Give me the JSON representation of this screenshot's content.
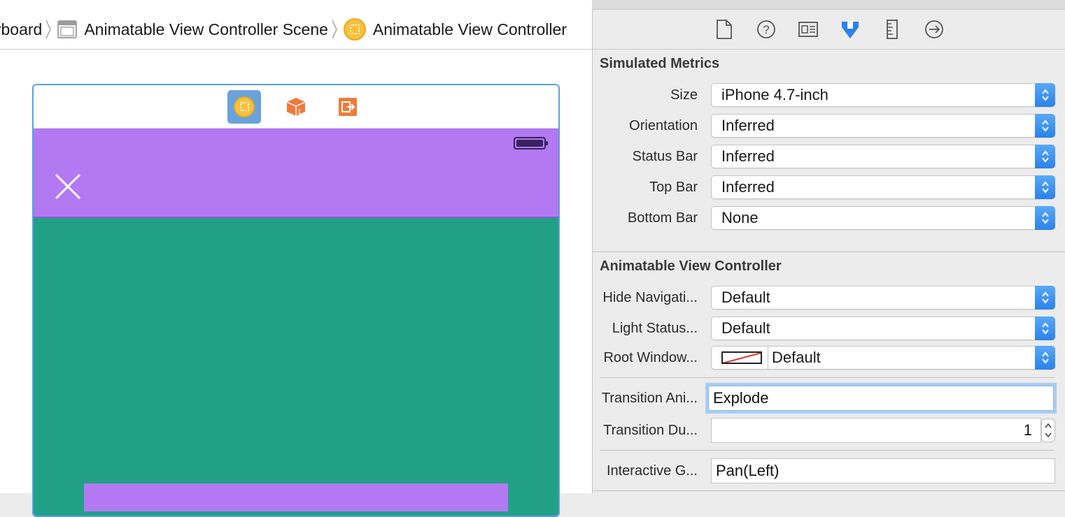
{
  "jumpbar": {
    "crumbs": [
      "yboard",
      "Animatable View Controller Scene",
      "Animatable View Controller"
    ]
  },
  "scene": {
    "dock_icons": [
      "view-controller-icon",
      "first-responder-icon",
      "exit-icon"
    ],
    "header_color": "#b279f2",
    "content_color": "#22a086"
  },
  "inspector": {
    "tab_icons": [
      "file-inspector-icon",
      "quick-help-icon",
      "identity-inspector-icon",
      "attributes-inspector-icon",
      "size-inspector-icon",
      "connections-inspector-icon"
    ],
    "simulated_metrics": {
      "title": "Simulated Metrics",
      "rows": [
        {
          "label": "Size",
          "value": "iPhone 4.7-inch"
        },
        {
          "label": "Orientation",
          "value": "Inferred"
        },
        {
          "label": "Status Bar",
          "value": "Inferred"
        },
        {
          "label": "Top Bar",
          "value": "Inferred"
        },
        {
          "label": "Bottom Bar",
          "value": "None"
        }
      ]
    },
    "animatable_vc": {
      "title": "Animatable View Controller",
      "hide_nav": {
        "label": "Hide Navigati...",
        "value": "Default"
      },
      "light_status": {
        "label": "Light Status...",
        "value": "Default"
      },
      "root_window": {
        "label": "Root Window...",
        "value": "Default"
      },
      "transition_animation": {
        "label": "Transition Ani...",
        "value": "Explode"
      },
      "transition_duration": {
        "label": "Transition Du...",
        "value": "1"
      },
      "interactive_gesture": {
        "label": "Interactive G...",
        "value": "Pan(Left)"
      }
    },
    "accent": "#2a82ea"
  }
}
